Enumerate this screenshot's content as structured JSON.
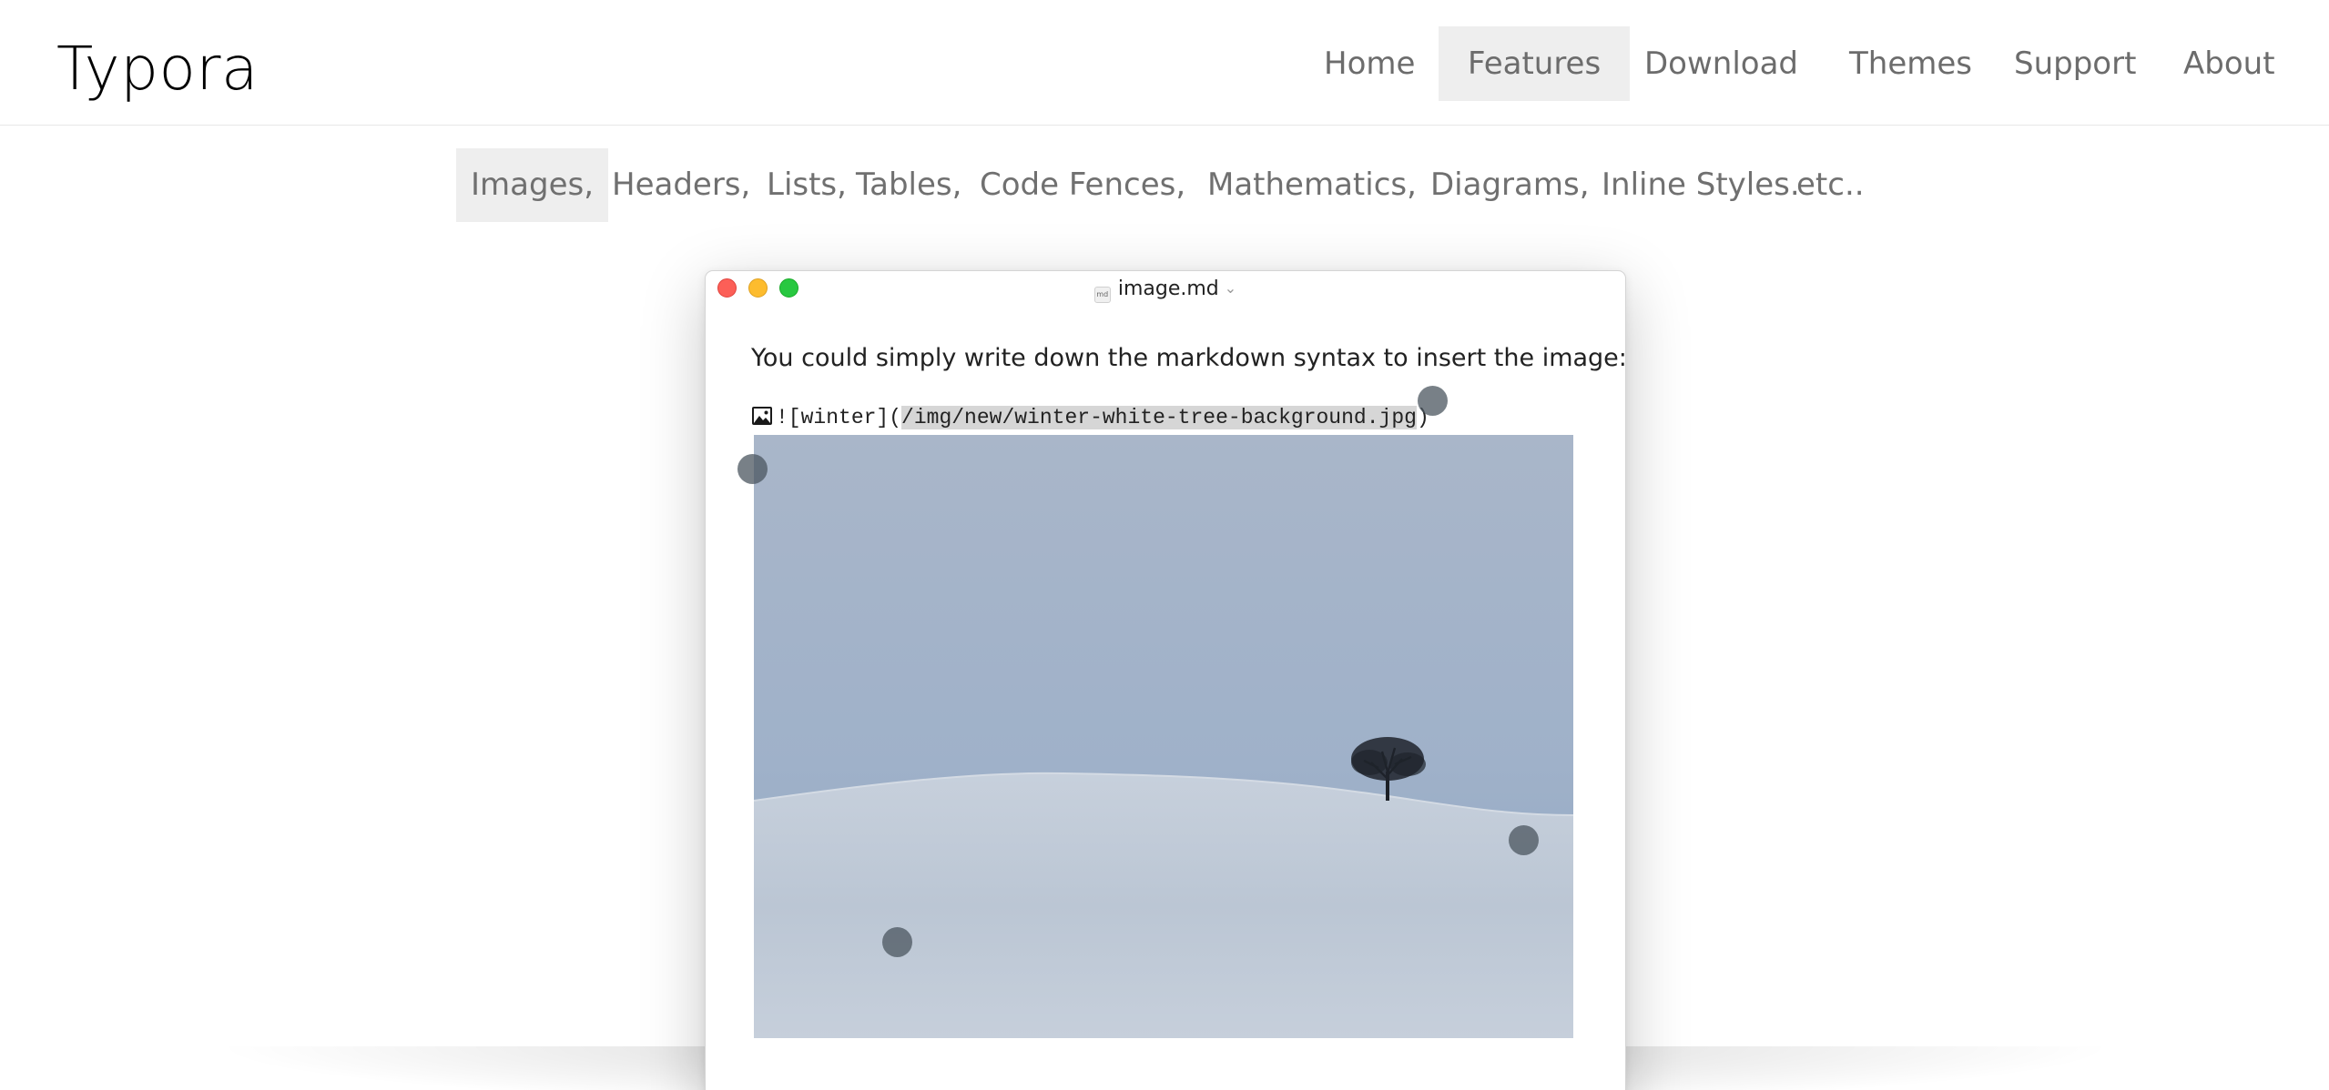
{
  "brand": {
    "logo_text": "Typora"
  },
  "main_nav": {
    "items": [
      {
        "label": "Home"
      },
      {
        "label": "Features",
        "active": true
      },
      {
        "label": "Download"
      },
      {
        "label": "Themes"
      },
      {
        "label": "Support"
      },
      {
        "label": "About"
      }
    ]
  },
  "feature_nav": {
    "items": [
      {
        "label": "Images,",
        "active": true
      },
      {
        "label": "Headers,"
      },
      {
        "label": "Lists,"
      },
      {
        "label": "Tables,"
      },
      {
        "label": "Code Fences,"
      },
      {
        "label": "Mathematics,"
      },
      {
        "label": "Diagrams,"
      },
      {
        "label": "Inline Styles."
      },
      {
        "label": "etc.."
      }
    ]
  },
  "window": {
    "file_name": "image.md",
    "file_icon_text": "md",
    "instruction_text": "You could simply write down the markdown syntax to insert the image:",
    "markdown": {
      "prefix": "![winter](",
      "url": "/img/new/winter-white-tree-background.jpg",
      "suffix": ")"
    },
    "image_alt": "winter"
  },
  "colors": {
    "traffic_close": "#fc5f57",
    "traffic_minimize": "#fdbc2e",
    "traffic_maximize": "#28c840",
    "active_tab_bg": "#eeeeee",
    "nav_text": "#6c6c6c"
  }
}
